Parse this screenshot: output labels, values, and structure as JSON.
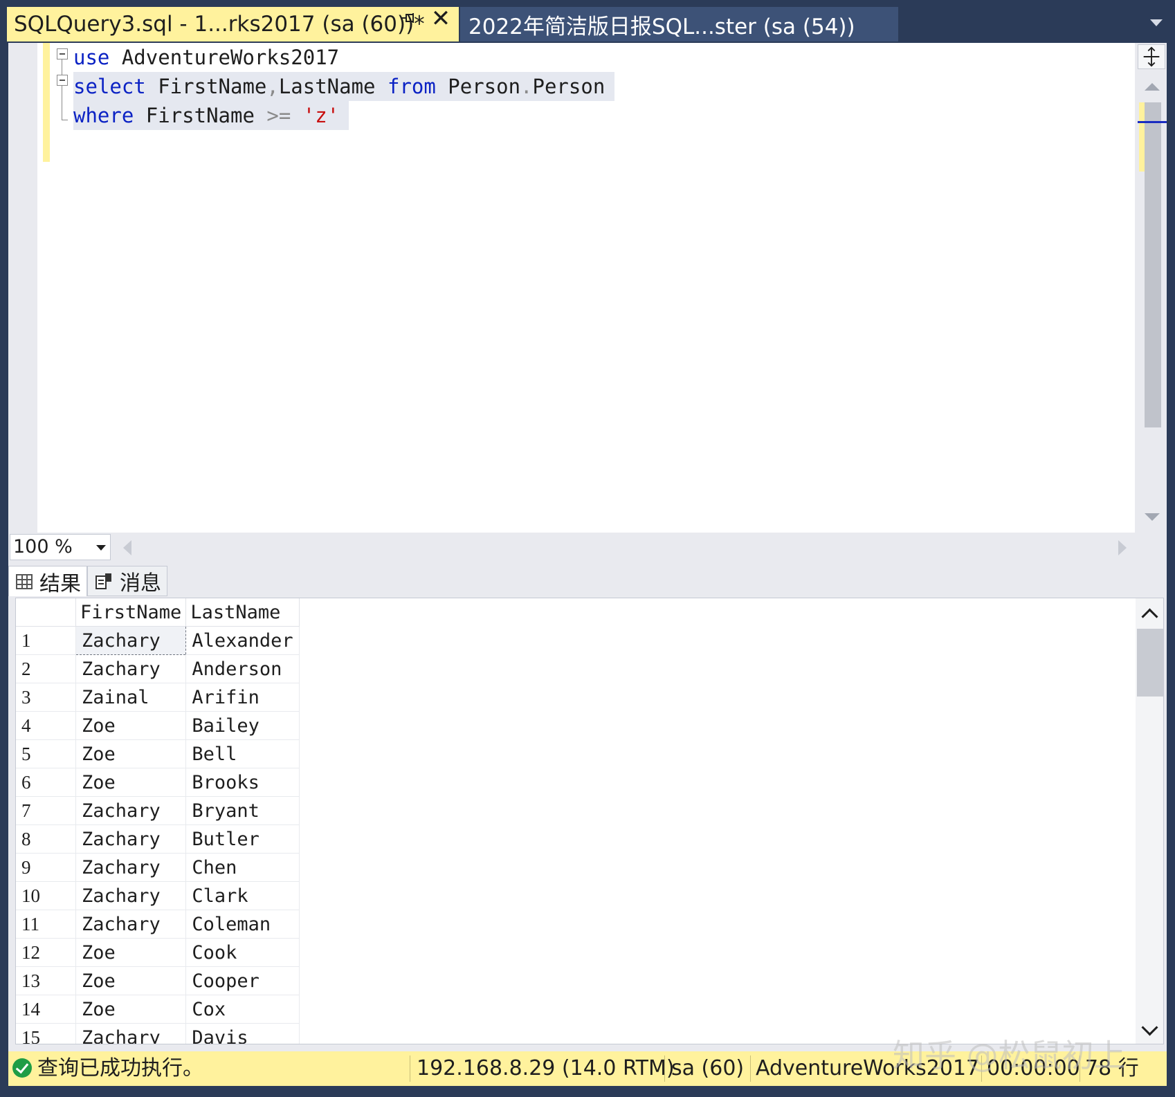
{
  "tabs": {
    "active_title": "SQLQuery3.sql - 1...rks2017 (sa (60))*",
    "inactive_title": "2022年简洁版日报SQL...ster (sa (54))"
  },
  "editor": {
    "line1": {
      "kw": "use",
      "rest": " AdventureWorks2017"
    },
    "line2": {
      "kw1": "select",
      "a": " FirstName",
      "comma": ",",
      "b": "LastName ",
      "kw2": "from",
      "c": " Person",
      "dot": ".",
      "d": "Person"
    },
    "line3": {
      "kw": "where",
      "a": " FirstName ",
      "op": ">=",
      "str": " 'z'"
    }
  },
  "zoom": {
    "value": "100 %"
  },
  "results": {
    "tab_results": "结果",
    "tab_messages": "消息",
    "columns": [
      "FirstName",
      "LastName"
    ],
    "rows": [
      [
        "1",
        "Zachary",
        "Alexander"
      ],
      [
        "2",
        "Zachary",
        "Anderson"
      ],
      [
        "3",
        "Zainal",
        "Arifin"
      ],
      [
        "4",
        "Zoe",
        "Bailey"
      ],
      [
        "5",
        "Zoe",
        "Bell"
      ],
      [
        "6",
        "Zoe",
        "Brooks"
      ],
      [
        "7",
        "Zachary",
        "Bryant"
      ],
      [
        "8",
        "Zachary",
        "Butler"
      ],
      [
        "9",
        "Zachary",
        "Chen"
      ],
      [
        "10",
        "Zachary",
        "Clark"
      ],
      [
        "11",
        "Zachary",
        "Coleman"
      ],
      [
        "12",
        "Zoe",
        "Cook"
      ],
      [
        "13",
        "Zoe",
        "Cooper"
      ],
      [
        "14",
        "Zoe",
        "Cox"
      ],
      [
        "15",
        "Zachary",
        "Davis"
      ]
    ]
  },
  "status": {
    "message": "查询已成功执行。",
    "server": "192.168.8.29 (14.0 RTM)",
    "user": "sa (60)",
    "database": "AdventureWorks2017",
    "elapsed": "00:00:00",
    "rows": "78 行"
  },
  "watermark": "知乎 @松鼠初上",
  "colors": {
    "accent_yellow": "#fff29d",
    "chrome": "#2b3b58",
    "keyword": "#0b22c4",
    "string": "#c80f0f"
  }
}
